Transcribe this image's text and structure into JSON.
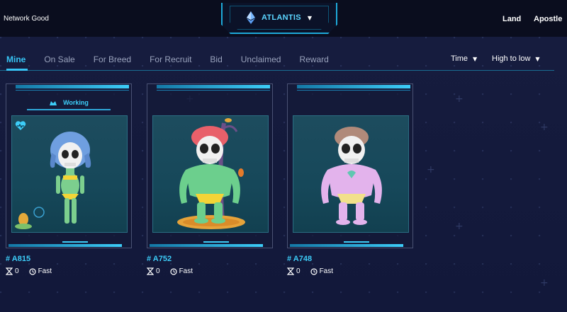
{
  "header": {
    "network_status": "Network Good",
    "network": "ATLANTIS",
    "links": [
      "Land",
      "Apostle"
    ]
  },
  "tabs": [
    "Mine",
    "On Sale",
    "For Breed",
    "For Recruit",
    "Bid",
    "Unclaimed",
    "Reward"
  ],
  "active_tab": "Mine",
  "sort": {
    "field": "Time",
    "order": "High to low"
  },
  "apostles": [
    {
      "id": "# A815",
      "status": "Working",
      "count": "0",
      "speed": "Fast",
      "hair_color": "#6f9fe0",
      "skin_color": "#7ccf8e",
      "outfit": "bikini"
    },
    {
      "id": "# A752",
      "status": "",
      "count": "0",
      "speed": "Fast",
      "hair_color": "#e8606a",
      "skin_color": "#6ccf8d",
      "outfit": "trunks"
    },
    {
      "id": "# A748",
      "status": "",
      "count": "0",
      "speed": "Fast",
      "hair_color": "#b08a7a",
      "skin_color": "#e3b3ec",
      "outfit": "trunks"
    }
  ],
  "colors": {
    "accent": "#37c4f5",
    "background": "#151a3a",
    "topbar": "#0a0d1e"
  }
}
